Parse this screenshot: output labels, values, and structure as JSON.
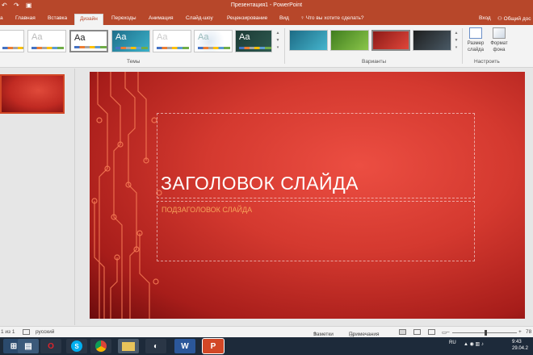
{
  "window": {
    "title": "Презентация1 - PowerPoint"
  },
  "tabs": [
    {
      "label": "а"
    },
    {
      "label": "Главная"
    },
    {
      "label": "Вставка"
    },
    {
      "label": "Дизайн"
    },
    {
      "label": "Переходы"
    },
    {
      "label": "Анимация"
    },
    {
      "label": "Слайд-шоу"
    },
    {
      "label": "Рецензирование"
    },
    {
      "label": "Вид"
    }
  ],
  "tell_me": "Что вы хотите сделать?",
  "account": {
    "signin": "Вход",
    "share": "Общий дос"
  },
  "ribbon": {
    "themes_label": "Темы",
    "variants_label": "Варианты",
    "customize_label": "Настроить",
    "theme_sample": "Aa",
    "slide_size_label": "Размер слайда",
    "format_bg_label": "Формат фона"
  },
  "slide": {
    "title": "ЗАГОЛОВОК СЛАЙДА",
    "subtitle": "ПОДЗАГОЛОВОК СЛАЙДА"
  },
  "status": {
    "slide_count": "1 из 1",
    "language": "русский",
    "notes": "Заметки",
    "comments": "Примечания",
    "zoom": "78"
  },
  "taskbar": {
    "lang": "RU",
    "time": "9:43",
    "date": "29.04.2"
  },
  "colors": {
    "accent": "#b7472a",
    "slide_bg": "#d4392f",
    "subtitle": "#f6a25a"
  }
}
